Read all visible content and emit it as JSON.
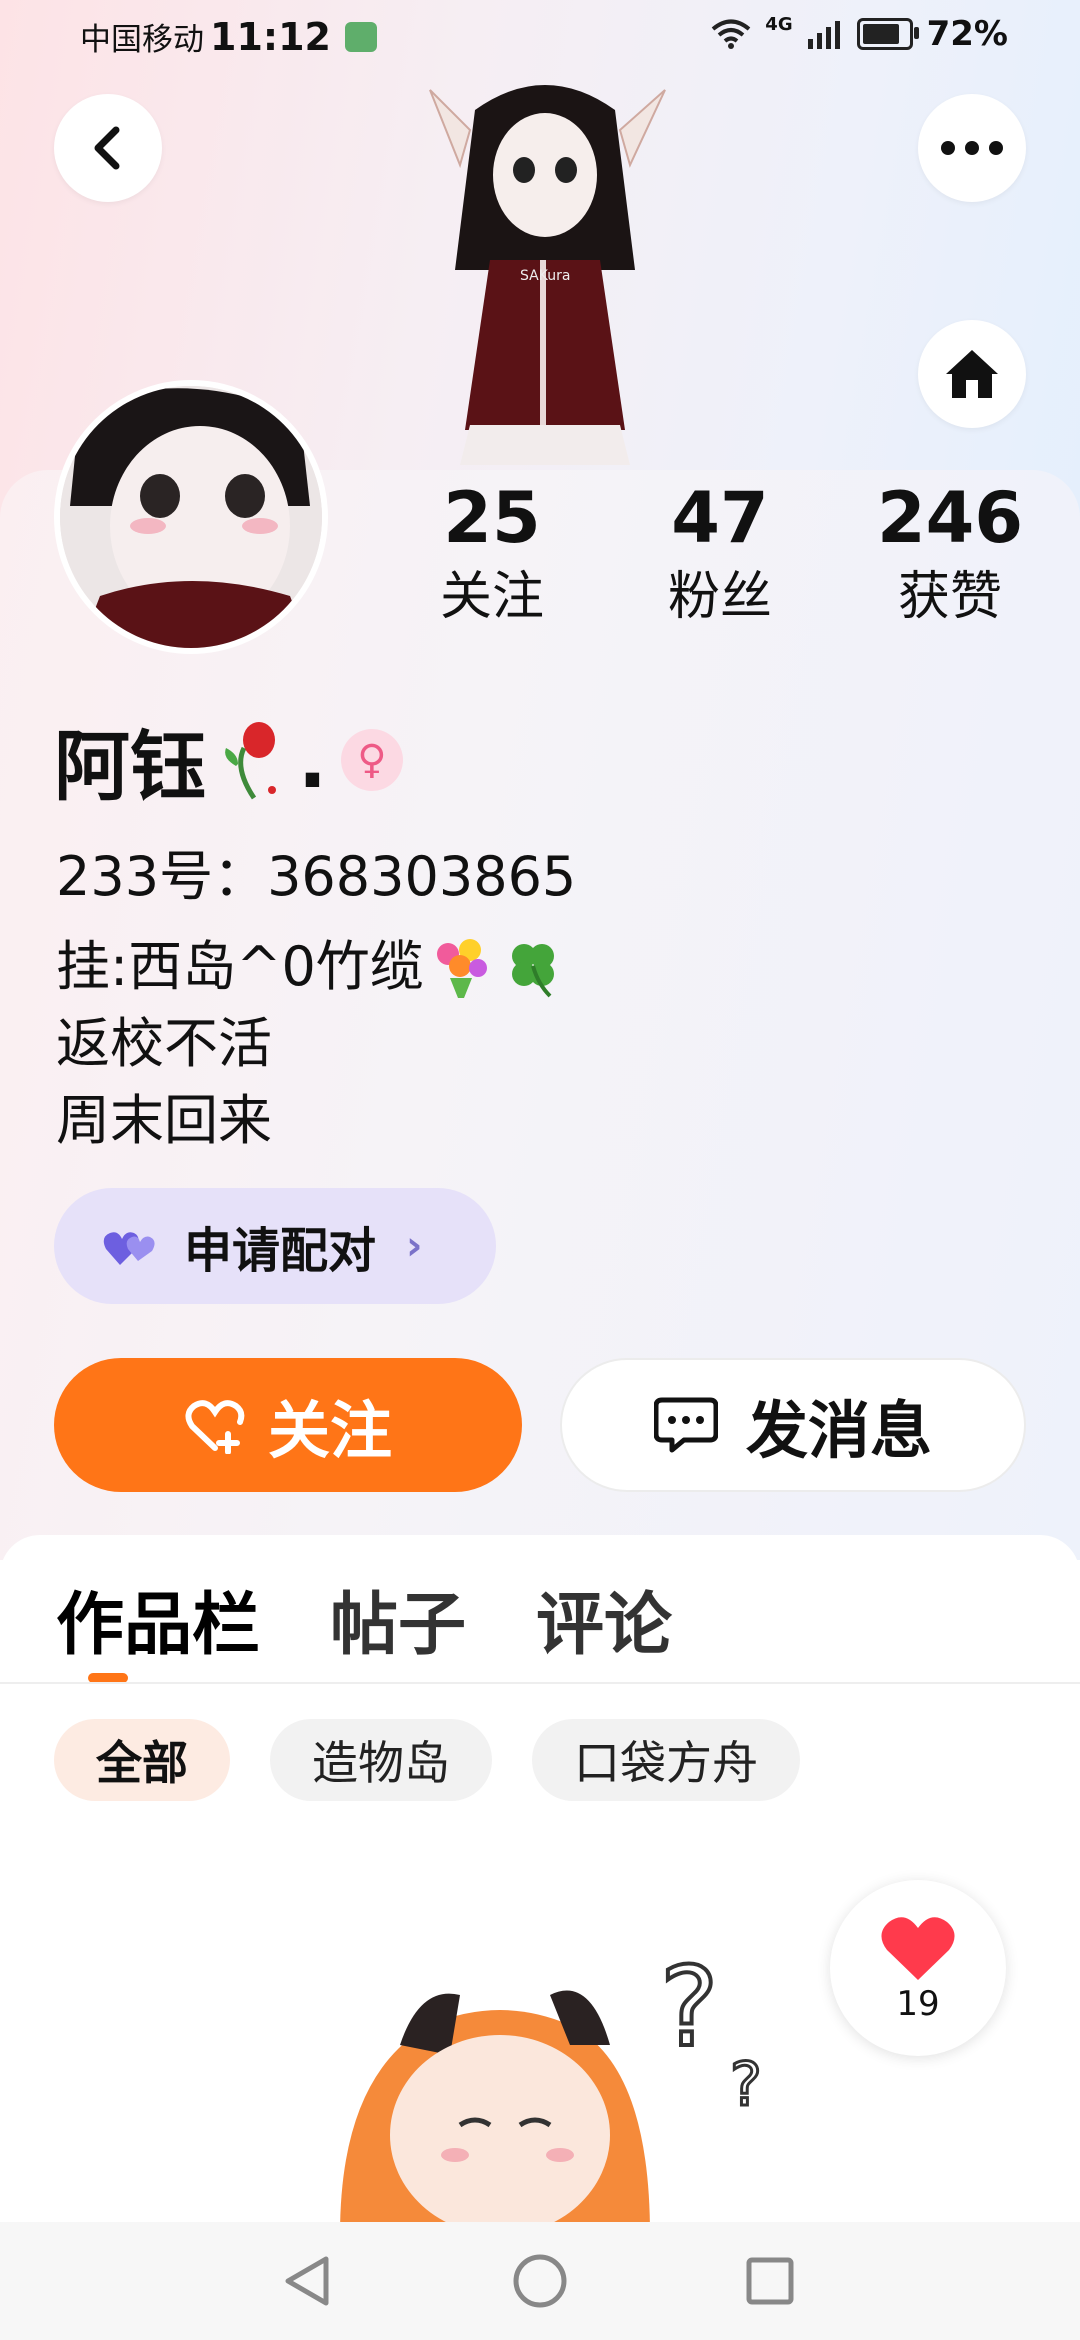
{
  "status_bar": {
    "carrier": "中国移动",
    "time": "11:12",
    "network": "4G",
    "battery": "72%",
    "battery_level": 0.72
  },
  "header": {
    "back_icon": "chevron-left-icon",
    "more_icon": "ellipsis-icon",
    "home_icon": "home-icon"
  },
  "profile": {
    "stats": [
      {
        "num": "25",
        "label": "关注"
      },
      {
        "num": "47",
        "label": "粉丝"
      },
      {
        "num": "246",
        "label": "获赞"
      }
    ],
    "name": "阿钰",
    "name_suffix": ".",
    "gender_symbol": "♀",
    "id_text": "233号：368303865",
    "bio": [
      "挂:西岛^0竹缆",
      "返校不活",
      "周末回来"
    ],
    "pair_button": "申请配对",
    "follow_button": "关注",
    "message_button": "发消息"
  },
  "tabs": [
    "作品栏",
    "帖子",
    "评论"
  ],
  "chips": [
    "全部",
    "造物岛",
    "口袋方舟"
  ],
  "like": {
    "count": "19"
  },
  "colors": {
    "accent": "#ff7517",
    "pair_bg": "#e6e1f9",
    "pair_heart": "#7467e0",
    "gender_bg": "#fcd9e3"
  }
}
